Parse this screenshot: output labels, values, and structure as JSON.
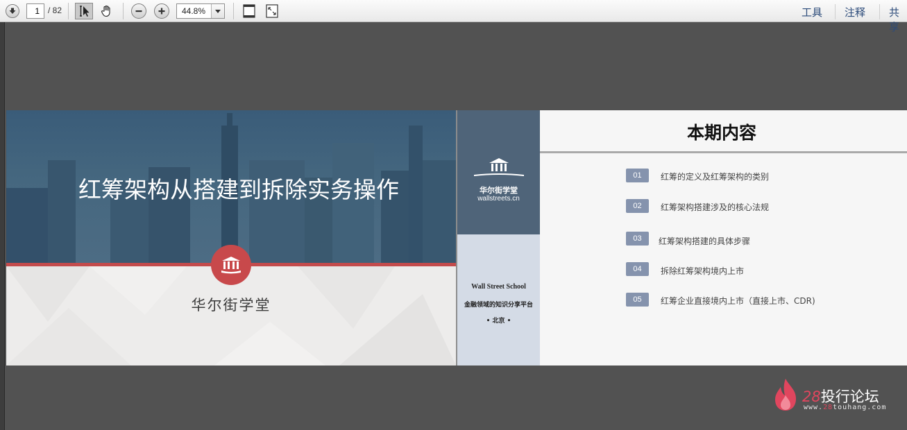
{
  "toolbar": {
    "page_current": "1",
    "page_total": "/ 82",
    "zoom": "44.8%",
    "menu": [
      "工具",
      "注释",
      "共享"
    ]
  },
  "slide": {
    "hero_title": "红筹架构从搭建到拆除实务操作",
    "lower_title": "华尔街学堂",
    "middle": {
      "brand_cn": "华尔街学堂",
      "brand_url": "wallstreets.cn",
      "brand_en": "Wall Street School",
      "slogan": "金融领域的知识分享平台",
      "city": "• 北京 •"
    },
    "toc": {
      "title": "本期内容",
      "items": [
        {
          "num": "01",
          "text": "红筹的定义及红筹架构的类别"
        },
        {
          "num": "02",
          "text": "红筹架构搭建涉及的核心法规"
        },
        {
          "num": "03",
          "text": "红筹架构搭建的具体步骤"
        },
        {
          "num": "04",
          "text": "拆除红筹架构境内上市"
        },
        {
          "num": "05",
          "text": "红筹企业直接境内上市（直接上市、CDR)"
        }
      ]
    }
  },
  "watermark": {
    "brand_num": "28",
    "brand_text": "投行论坛",
    "url_pre": "www.",
    "url_hl": "28",
    "url_post": "touhang.com"
  },
  "colors": {
    "accent_red": "#c8494b",
    "toc_badge": "#8593ad",
    "hero_blue": "#45677f"
  }
}
